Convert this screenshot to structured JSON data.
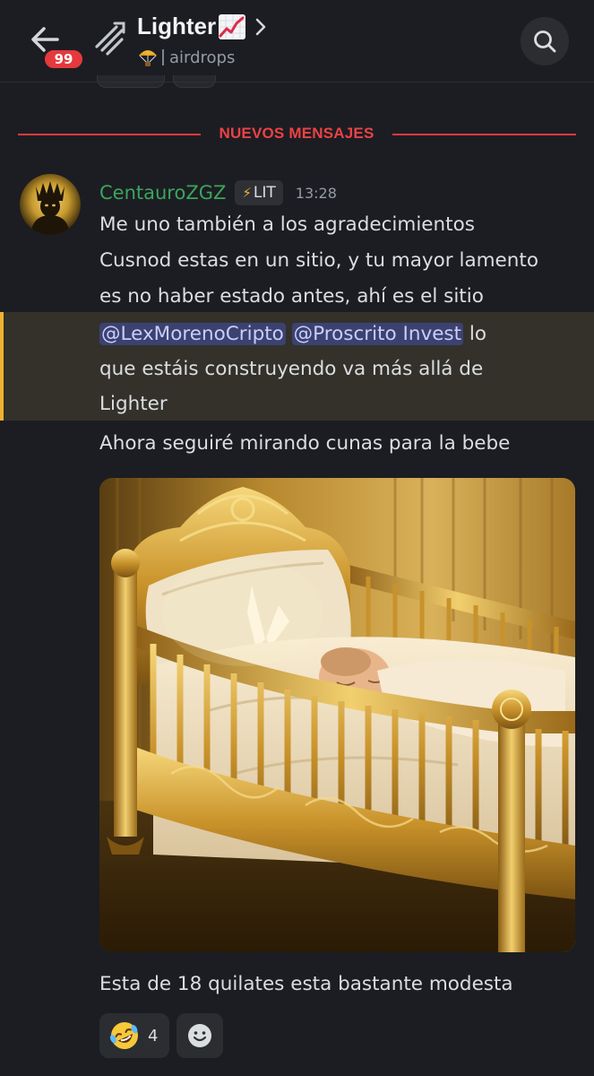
{
  "header": {
    "title": "Lighter",
    "title_emoji": "chart-increasing-icon",
    "subtitle": "airdrops",
    "subtitle_emoji": "parachute-icon",
    "unread_badge": "99"
  },
  "divider": {
    "label": "NUEVOS MENSAJES",
    "color": "#e5393d"
  },
  "message": {
    "author": "CentauroZGZ",
    "author_color": "#3ba55d",
    "role_icon": "⚡",
    "role_tag": "LIT",
    "time": "13:28",
    "lines": [
      "Me uno también a los agradecimientos",
      "Cusnod estas en un sitio, y tu mayor lamento",
      "es no haber estado antes, ahí es el sitio"
    ],
    "highlight": {
      "mention1": "@LexMorenoCripto",
      "mention2": "@Proscrito Invest",
      "after_mentions": " lo",
      "line2": "que estáis construyendo va más allá de",
      "line3": "Lighter"
    },
    "last_line": "Ahora seguiré mirando cunas para la bebe",
    "attachment_alt": "golden-crib-image",
    "caption": "Esta de 18 quilates esta bastante modesta"
  },
  "reactions": [
    {
      "emoji": "rolling-on-floor-laughing-icon",
      "count": "4"
    }
  ],
  "colors": {
    "background": "#1c1d22",
    "highlight_bg": "#33312a",
    "highlight_bar": "#f0b232",
    "mention_bg": "#3c4270"
  }
}
